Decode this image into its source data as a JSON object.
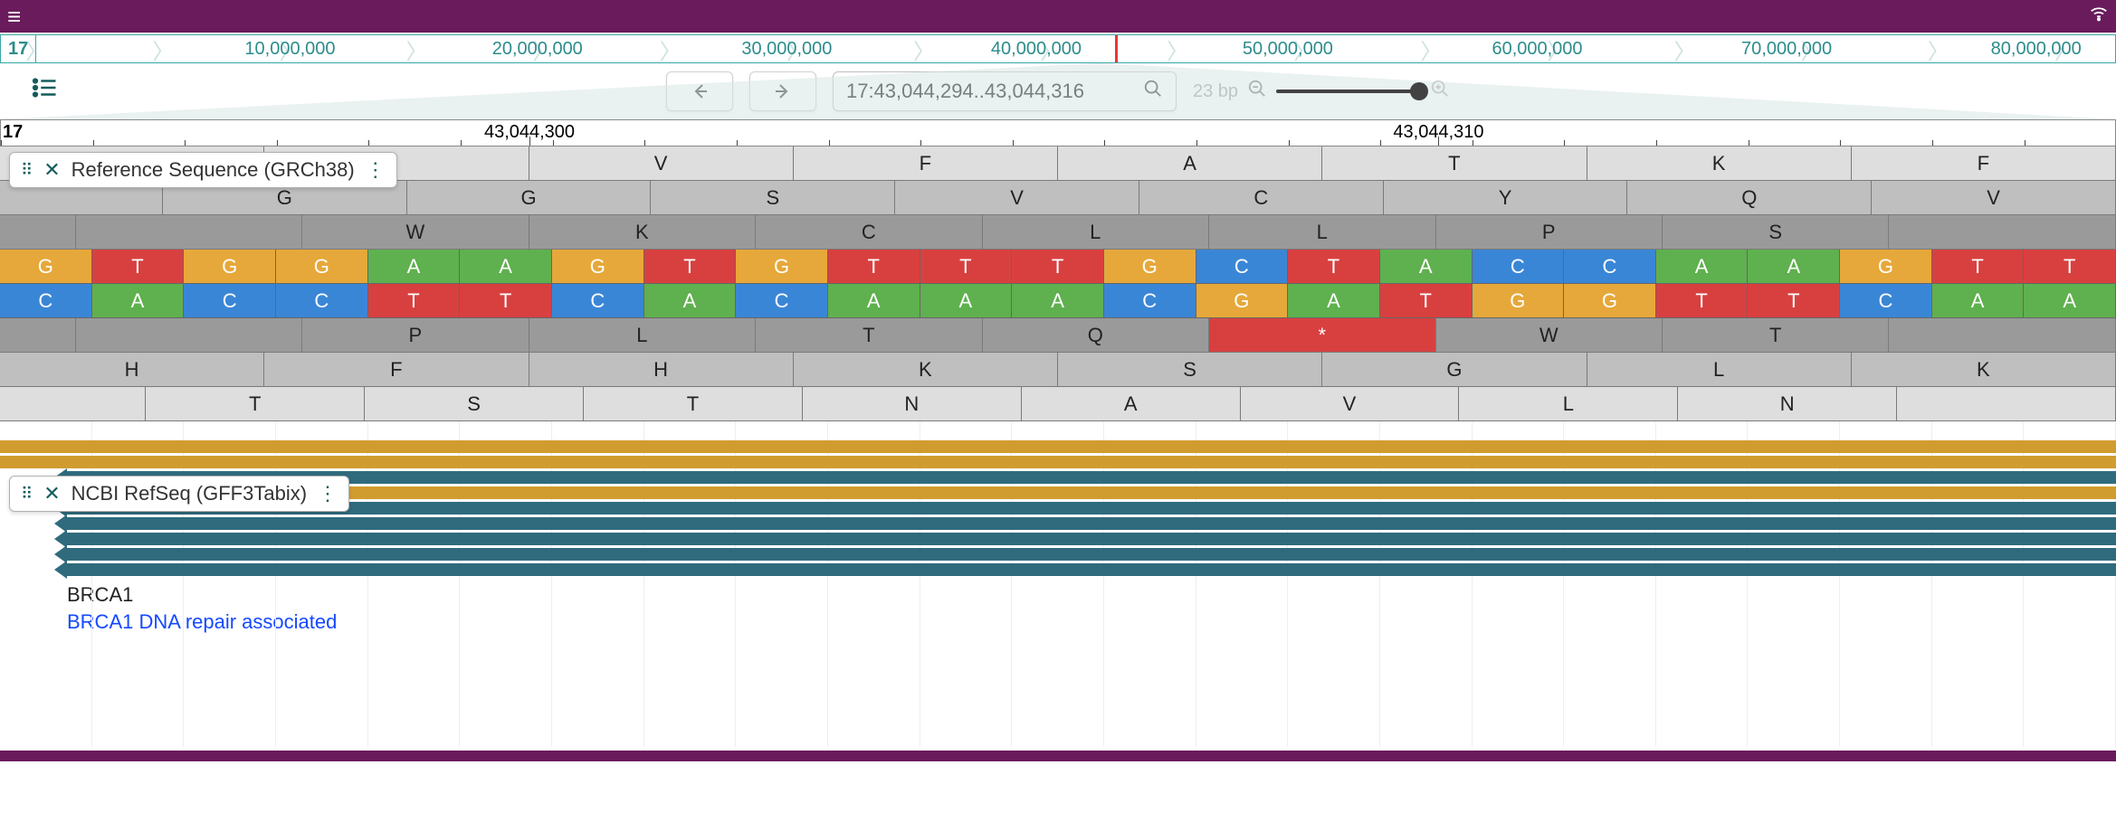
{
  "header": {
    "hamburger_icon": "≡",
    "wifi_icon": "⌔"
  },
  "overview": {
    "chromosome": "17",
    "ticks": [
      {
        "label": "10,000,000",
        "pct": 12.2
      },
      {
        "label": "20,000,000",
        "pct": 24.1
      },
      {
        "label": "30,000,000",
        "pct": 36.1
      },
      {
        "label": "40,000,000",
        "pct": 48.1
      },
      {
        "label": "50,000,000",
        "pct": 60.2
      },
      {
        "label": "60,000,000",
        "pct": 72.2
      },
      {
        "label": "70,000,000",
        "pct": 84.2
      },
      {
        "label": "80,000,000",
        "pct": 96.2
      }
    ],
    "marker_pct": 51.9
  },
  "nav": {
    "back_icon": "←",
    "fwd_icon": "→",
    "tracklist_icon": "track-selector",
    "location": "17:43,044,294..43,044,316",
    "search_icon": "🔍",
    "zoom_label": "23 bp",
    "zoom_out_icon": "−",
    "zoom_in_icon": "+"
  },
  "detail_ruler": {
    "chromosome": "17",
    "ticks": [
      {
        "label": "43,044,300",
        "pct": 25.0
      },
      {
        "label": "43,044,310",
        "pct": 68.0
      }
    ]
  },
  "tracks": {
    "ref": {
      "title": "Reference Sequence (GRCh38)",
      "aa_rows": [
        {
          "shade": "light",
          "offset": 0,
          "cells": [
            "",
            "",
            "V",
            "F",
            "A",
            "T",
            "K",
            "F"
          ]
        },
        {
          "shade": "med",
          "offset": 2,
          "cells": [
            "G",
            "G",
            "S",
            "V",
            "C",
            "Y",
            "Q",
            "V"
          ]
        },
        {
          "shade": "dark",
          "offset": 1,
          "cells": [
            "",
            "W",
            "K",
            "C",
            "L",
            "L",
            "P",
            "S",
            ""
          ]
        }
      ],
      "fwd_bases": [
        "G",
        "T",
        "G",
        "G",
        "A",
        "A",
        "G",
        "T",
        "G",
        "T",
        "T",
        "T",
        "G",
        "C",
        "T",
        "A",
        "C",
        "C",
        "A",
        "A",
        "G",
        "T",
        "T"
      ],
      "rev_bases": [
        "C",
        "A",
        "C",
        "C",
        "T",
        "T",
        "C",
        "A",
        "C",
        "A",
        "A",
        "A",
        "C",
        "G",
        "A",
        "T",
        "G",
        "G",
        "T",
        "T",
        "C",
        "A",
        "A"
      ],
      "aa_rows_below": [
        {
          "shade": "dark",
          "offset": 1,
          "cells": [
            "",
            "P",
            "L",
            "T",
            "Q",
            "*",
            "W",
            "T",
            ""
          ],
          "stops": [
            5
          ]
        },
        {
          "shade": "med",
          "offset": 0,
          "cells": [
            "H",
            "F",
            "H",
            "K",
            "S",
            "G",
            "L",
            "K"
          ]
        },
        {
          "shade": "light",
          "offset": 2,
          "cells": [
            "T",
            "S",
            "T",
            "N",
            "A",
            "V",
            "L",
            "N",
            ""
          ]
        }
      ]
    },
    "gene": {
      "title": "NCBI RefSeq (GFF3Tabix)",
      "bands": [
        {
          "color": "gold",
          "arrow": false,
          "full": true
        },
        {
          "color": "gold",
          "arrow": false,
          "full": true
        },
        {
          "color": "teal",
          "arrow": true
        },
        {
          "color": "gold",
          "arrow": true
        },
        {
          "color": "teal",
          "arrow": true
        },
        {
          "color": "teal",
          "arrow": true
        },
        {
          "color": "teal",
          "arrow": true
        },
        {
          "color": "teal",
          "arrow": true
        },
        {
          "color": "teal",
          "arrow": true
        }
      ],
      "name": "BRCA1",
      "description": "BRCA1 DNA repair associated"
    }
  }
}
